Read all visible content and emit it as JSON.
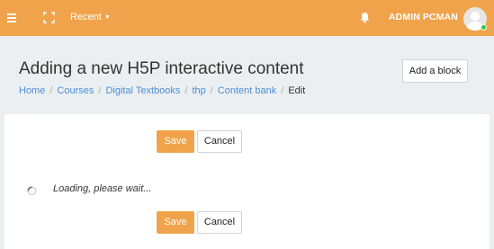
{
  "header": {
    "menu_icon": "hamburger-icon",
    "fullscreen_icon": "fullscreen-icon",
    "recent_label": "Recent",
    "notifications_icon": "bell-icon",
    "user_name": "ADMIN PCMAN",
    "brand_color": "#f0a34a",
    "status_color": "#2ecc40"
  },
  "page": {
    "title": "Adding a new H5P interactive content",
    "add_block_label": "Add a block"
  },
  "breadcrumb": {
    "items": [
      "Home",
      "Courses",
      "Digital Textbooks",
      "thp",
      "Content bank"
    ],
    "current": "Edit",
    "separator": "/"
  },
  "form": {
    "save_label": "Save",
    "cancel_label": "Cancel",
    "loading_text": "Loading, please wait..."
  }
}
